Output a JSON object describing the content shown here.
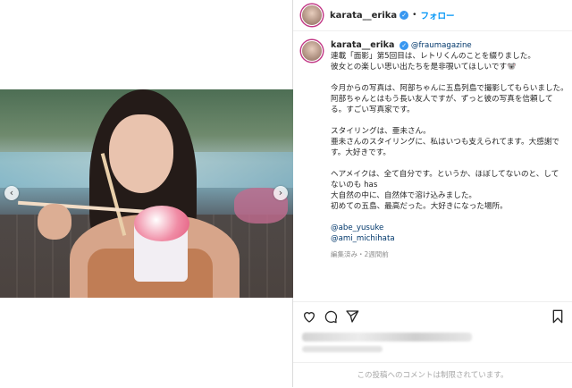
{
  "post": {
    "username": "karata__erika",
    "separator": "•",
    "follow_label": "フォロー"
  },
  "caption": {
    "username": "karata__erika",
    "tag": "@fraumagazine",
    "lines": [
      "連載「面影」第5回目は、レトリくんのことを綴りました。",
      "彼女との楽しい思い出たちを是非覗いてほしいです🐨",
      "",
      "今月からの写真は、阿部ちゃんに五島列島で撮影してもらいました。",
      "阿部ちゃんとはもう長い友人ですが、ずっと彼の写真を信頼して",
      "る。すごい写真家です。",
      "",
      "スタイリングは、亜未さん。",
      "亜未さんのスタイリングに、私はいつも支えられてます。大感謝で",
      "す。大好きです。",
      "",
      "ヘアメイクは、全て自分です。というか、ほぼしてないのと、して",
      "ないのも has",
      "大自然の中に、自然体で溶け込みました。",
      "初めての五島、最高だった。大好きになった場所。"
    ],
    "mentions": [
      "@abe_yusuke",
      "@ami_michihata"
    ],
    "meta": "編集済み・2週間前"
  },
  "icons": {
    "like": "heart-icon",
    "comment": "comment-icon",
    "share": "share-icon",
    "save": "bookmark-icon",
    "prev": "chevron-left-icon",
    "next": "chevron-right-icon"
  },
  "comments": {
    "disabled_text": "この投稿へのコメントは制限されています。"
  },
  "colors": {
    "link": "#00376b",
    "follow": "#0095f6",
    "verified": "#3897f0"
  }
}
